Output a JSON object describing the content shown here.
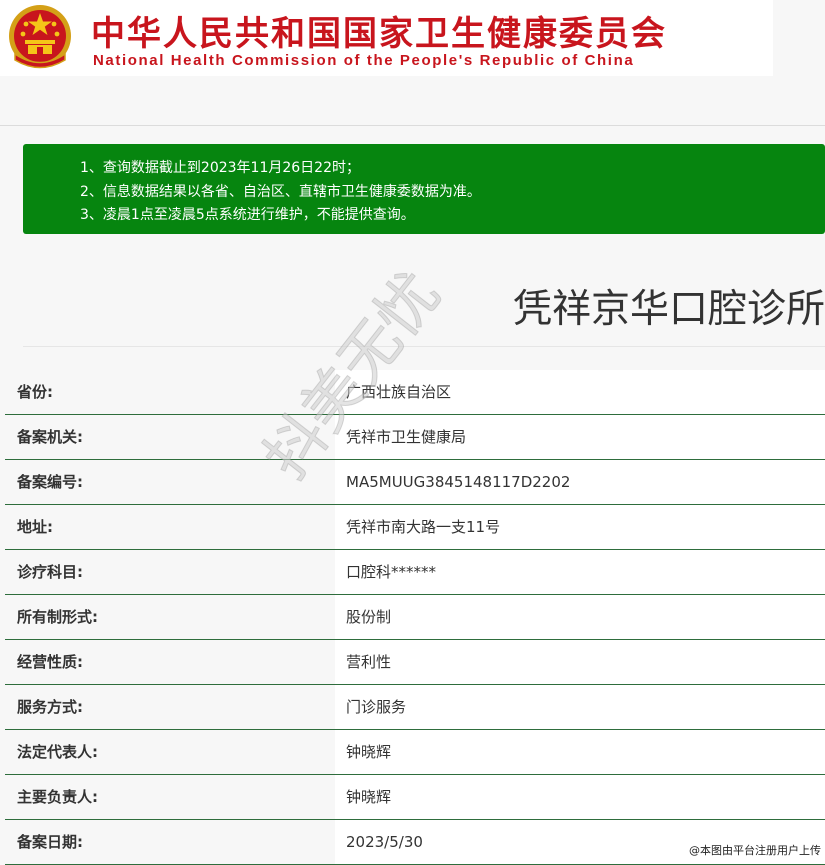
{
  "header": {
    "title_cn": "中华人民共和国国家卫生健康委员会",
    "title_en": "National Health Commission of the People's Republic of China",
    "emblem_icon": "national-emblem-icon"
  },
  "notice": {
    "items": [
      "1、查询数据截止到2023年11月26日22时；",
      "2、信息数据结果以各省、自治区、直辖市卫生健康委数据为准。",
      "3、凌晨1点至凌晨5点系统进行维护，不能提供查询。"
    ]
  },
  "clinic": {
    "name": "凭祥京华口腔诊所"
  },
  "details": [
    {
      "label": "省份:",
      "value": "广西壮族自治区"
    },
    {
      "label": "备案机关:",
      "value": "凭祥市卫生健康局"
    },
    {
      "label": "备案编号:",
      "value": "MA5MUUG3845148117D2202"
    },
    {
      "label": "地址:",
      "value": "凭祥市南大路一支11号"
    },
    {
      "label": "诊疗科目:",
      "value": "口腔科******"
    },
    {
      "label": "所有制形式:",
      "value": "股份制"
    },
    {
      "label": "经营性质:",
      "value": "营利性"
    },
    {
      "label": "服务方式:",
      "value": "门诊服务"
    },
    {
      "label": "法定代表人:",
      "value": "钟晓辉"
    },
    {
      "label": "主要负责人:",
      "value": "钟晓辉"
    },
    {
      "label": "备案日期:",
      "value": "2023/5/30"
    }
  ],
  "watermark": "抖美无忧",
  "credit": "@本图由平台注册用户上传",
  "colors": {
    "brand_red": "#c8151d",
    "notice_green": "#06850f",
    "row_border": "#2e6d3c"
  }
}
